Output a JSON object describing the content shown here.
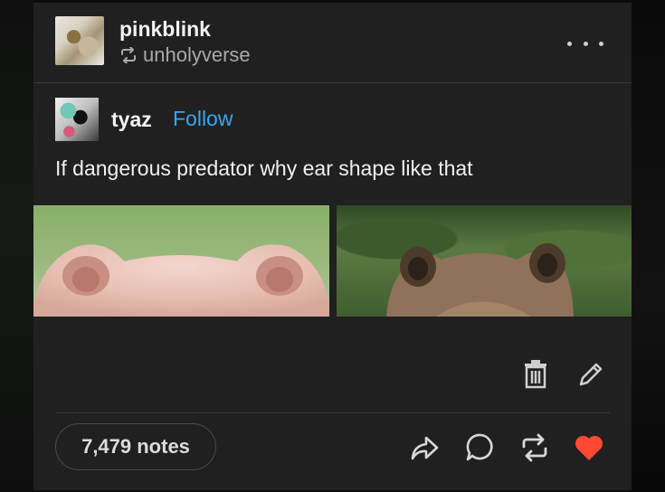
{
  "post": {
    "reblogger": {
      "username": "pinkblink",
      "reblogged_from": "unholyverse"
    },
    "original": {
      "username": "tyaz",
      "follow_label": "Follow"
    },
    "text": "If dangerous predator why ear shape like that",
    "notes": "7,479 notes",
    "liked": true
  },
  "icons": {
    "reblog_small": "reblog-icon",
    "more": "more-options-icon",
    "trash": "trash-icon",
    "edit": "pencil-icon",
    "share": "share-icon",
    "reply": "comment-icon",
    "reblog": "reblog-icon",
    "like": "heart-icon"
  },
  "colors": {
    "background": "#202020",
    "accent_link": "#3aa6f2",
    "like": "#ff4930",
    "text": "#f0f0f0",
    "muted": "#a9a9a9"
  }
}
